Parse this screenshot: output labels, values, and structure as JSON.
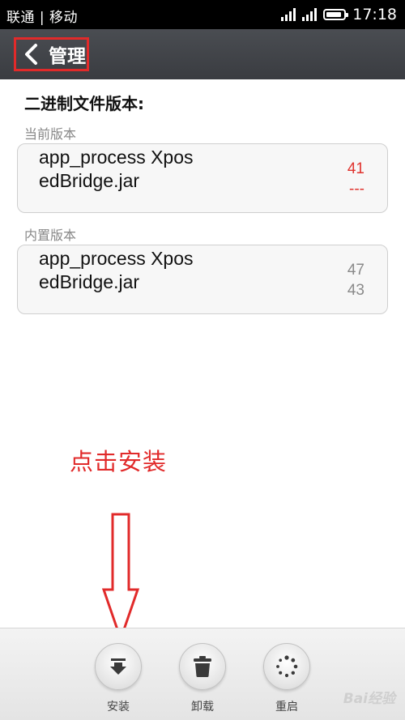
{
  "status_bar": {
    "carrier": "联通 | 移动",
    "time": "17:18"
  },
  "title_bar": {
    "title": "管理"
  },
  "content": {
    "section_title": "二进制文件版本:",
    "current_label": "当前版本",
    "builtin_label": "内置版本",
    "current": {
      "files": "app_process XposedBridge.jar",
      "values": [
        "41",
        "---"
      ]
    },
    "builtin": {
      "files": "app_process XposedBridge.jar",
      "values": [
        "47",
        "43"
      ]
    }
  },
  "annotation": {
    "text": "点击安装"
  },
  "toolbar": {
    "install_label": "安装",
    "uninstall_label": "卸载",
    "reboot_label": "重启"
  },
  "watermark": "Bai经验",
  "colors": {
    "accent_red": "#e12a2a",
    "title_bar": "#3f4247"
  }
}
